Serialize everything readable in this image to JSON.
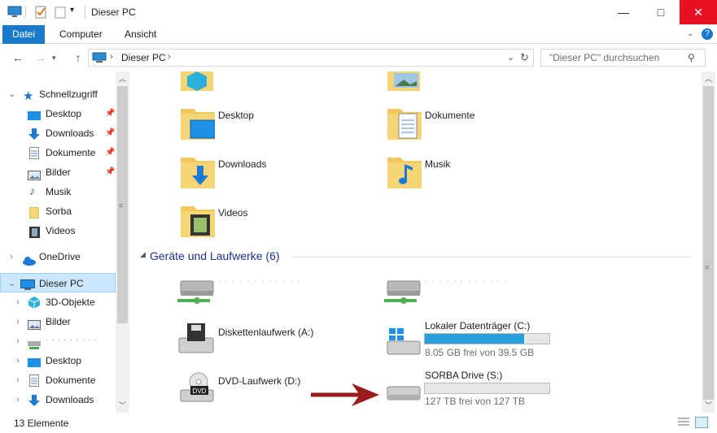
{
  "window": {
    "title": "Dieser PC",
    "minimize": "—",
    "maximize": "□",
    "close": "✕"
  },
  "ribbon": {
    "tabs": [
      "Datei",
      "Computer",
      "Ansicht"
    ]
  },
  "navigation": {
    "back": "←",
    "forward": "→",
    "up": "↑",
    "breadcrumb": "Dieser PC",
    "search_placeholder": "\"Dieser PC\" durchsuchen"
  },
  "navpane": {
    "quick_access": "Schnellzugriff",
    "quick_items": [
      "Desktop",
      "Downloads",
      "Dokumente",
      "Bilder",
      "Musik",
      "Sorba",
      "Videos"
    ],
    "onedrive": "OneDrive",
    "this_pc": "Dieser PC",
    "pc_items": [
      "3D-Objekte",
      "Bilder",
      "",
      "Desktop",
      "Dokumente",
      "Downloads"
    ]
  },
  "content": {
    "folders": [
      "Desktop",
      "Dokumente",
      "Downloads",
      "Musik",
      "Videos"
    ],
    "devices_header": "Geräte und Laufwerke (6)",
    "drives": {
      "floppy": "Diskettenlaufwerk (A:)",
      "local_c": "Lokaler Datenträger (C:)",
      "local_c_free": "8.05 GB frei von 39.5 GB",
      "local_c_used_fraction": 0.8,
      "dvd": "DVD-Laufwerk (D:)",
      "sorba": "SORBA Drive (S:)",
      "sorba_free": "127 TB frei von 127 TB",
      "sorba_used_fraction": 0.0
    }
  },
  "status": {
    "count": "13 Elemente"
  },
  "colors": {
    "accent": "#1979ca",
    "selection": "#cce8ff",
    "arrow": "#9b1b1f",
    "drive_fill": "#26a0da"
  }
}
